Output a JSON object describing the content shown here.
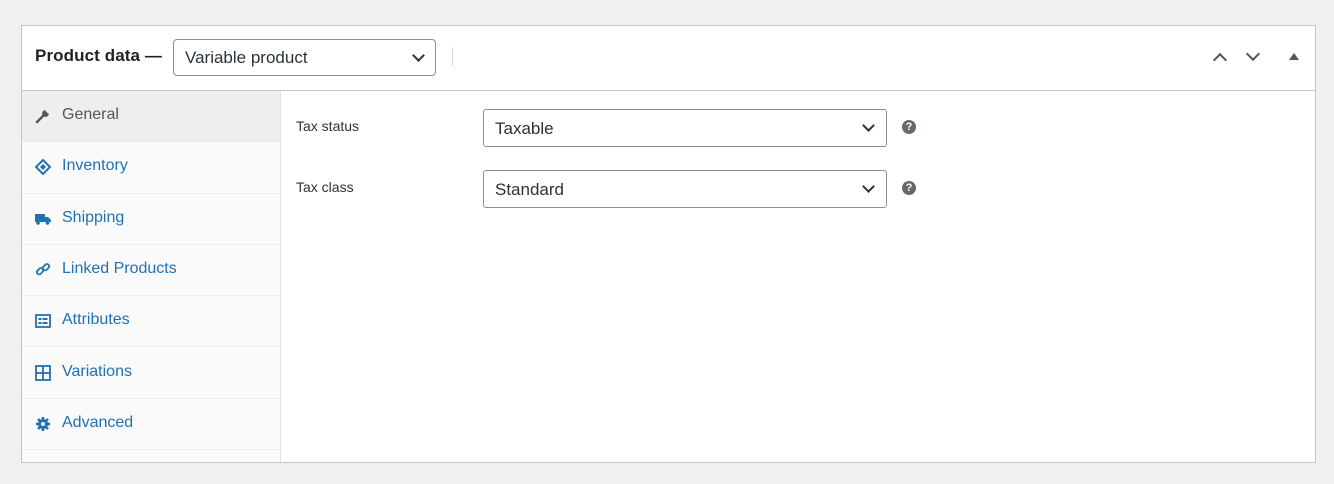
{
  "header": {
    "title": "Product data —",
    "product_type": "Variable product"
  },
  "tabs": [
    {
      "label": "General",
      "icon": "wrench-icon",
      "active": true
    },
    {
      "label": "Inventory",
      "icon": "tag-icon",
      "active": false
    },
    {
      "label": "Shipping",
      "icon": "truck-icon",
      "active": false
    },
    {
      "label": "Linked Products",
      "icon": "link-icon",
      "active": false
    },
    {
      "label": "Attributes",
      "icon": "list-card-icon",
      "active": false
    },
    {
      "label": "Variations",
      "icon": "grid-icon",
      "active": false
    },
    {
      "label": "Advanced",
      "icon": "gear-icon",
      "active": false
    }
  ],
  "fields": {
    "tax_status": {
      "label": "Tax status",
      "value": "Taxable"
    },
    "tax_class": {
      "label": "Tax class",
      "value": "Standard"
    }
  },
  "colors": {
    "link": "#2271b1",
    "active_tab_bg": "#eeeeee",
    "border": "#c3c4c7"
  }
}
